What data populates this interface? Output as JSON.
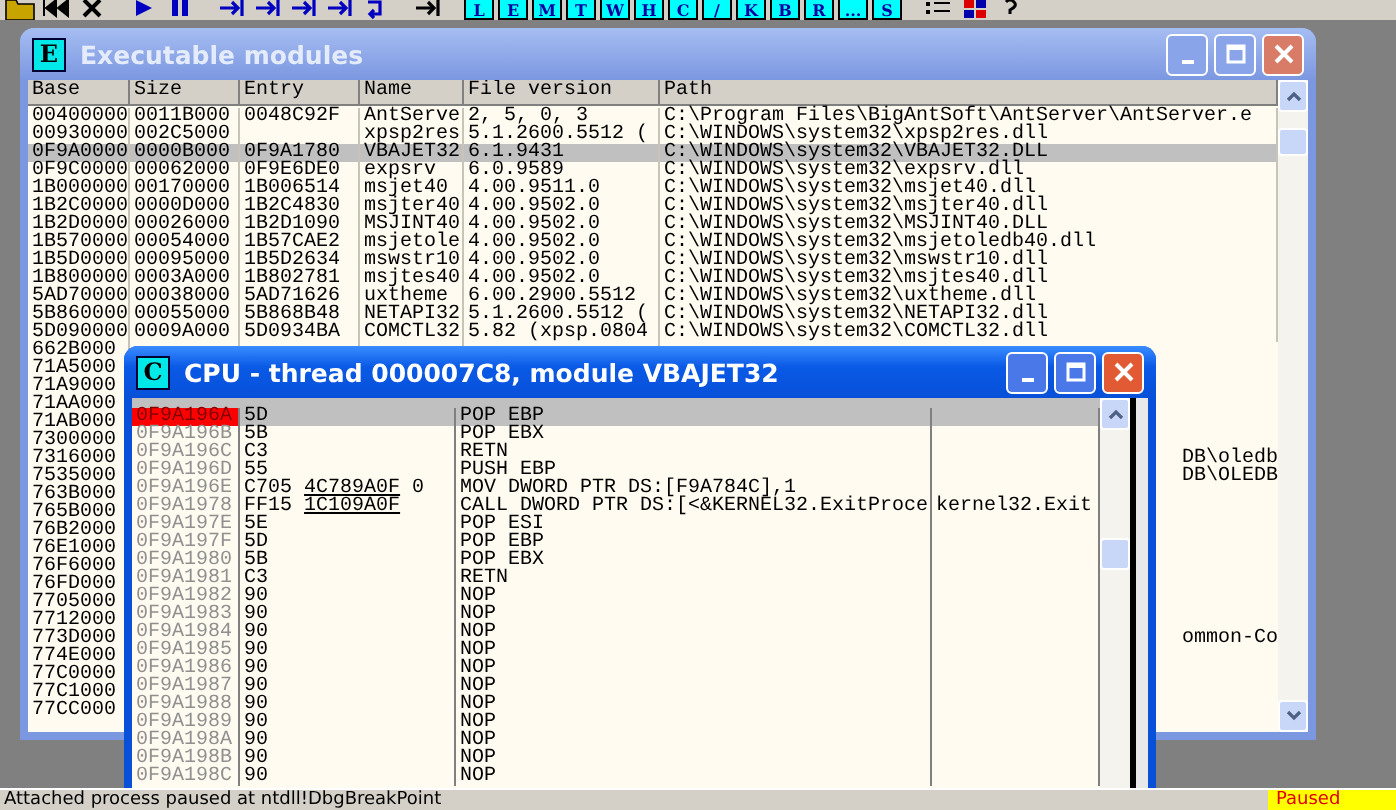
{
  "toolbar": {
    "letter_buttons": [
      "L",
      "E",
      "M",
      "T",
      "W",
      "H",
      "C",
      "/",
      "K",
      "B",
      "R",
      "...",
      "S"
    ]
  },
  "modules_window": {
    "badge": "E",
    "title": "Executable modules",
    "active": false,
    "columns": [
      "Base",
      "Size",
      "Entry",
      "Name",
      "File version",
      "Path"
    ],
    "rows": [
      {
        "base": "00400000",
        "size": "0011B000",
        "entry": "0048C92F",
        "name": "AntServe",
        "file_version": "2, 5, 0, 3",
        "path": "C:\\Program Files\\BigAntSoft\\AntServer\\AntServer.e",
        "selected": false
      },
      {
        "base": "00930000",
        "size": "002C5000",
        "name": "xpsp2res",
        "file_version": "5.1.2600.5512 (",
        "path": "C:\\WINDOWS\\system32\\xpsp2res.dll",
        "selected": false
      },
      {
        "base": "0F9A0000",
        "size": "0000B000",
        "entry": "0F9A1780",
        "name": "VBAJET32",
        "file_version": "6.1.9431",
        "path": "C:\\WINDOWS\\system32\\VBAJET32.DLL",
        "selected": true
      },
      {
        "base": "0F9C0000",
        "size": "00062000",
        "entry": "0F9E6DE0",
        "name": "expsrv",
        "file_version": "6.0.9589",
        "path": "C:\\WINDOWS\\system32\\expsrv.dll",
        "selected": false
      },
      {
        "base": "1B000000",
        "size": "00170000",
        "entry": "1B006514",
        "name": "msjet40",
        "file_version": "4.00.9511.0",
        "path": "C:\\WINDOWS\\system32\\msjet40.dll",
        "selected": false
      },
      {
        "base": "1B2C0000",
        "size": "0000D000",
        "entry": "1B2C4830",
        "name": "msjter40",
        "file_version": "4.00.9502.0",
        "path": "C:\\WINDOWS\\system32\\msjter40.dll",
        "selected": false
      },
      {
        "base": "1B2D0000",
        "size": "00026000",
        "entry": "1B2D1090",
        "name": "MSJINT40",
        "file_version": "4.00.9502.0",
        "path": "C:\\WINDOWS\\system32\\MSJINT40.DLL",
        "selected": false
      },
      {
        "base": "1B570000",
        "size": "00054000",
        "entry": "1B57CAE2",
        "name": "msjetole",
        "file_version": "4.00.9502.0",
        "path": "C:\\WINDOWS\\system32\\msjetoledb40.dll",
        "selected": false
      },
      {
        "base": "1B5D0000",
        "size": "00095000",
        "entry": "1B5D2634",
        "name": "mswstr10",
        "file_version": "4.00.9502.0",
        "path": "C:\\WINDOWS\\system32\\mswstr10.dll",
        "selected": false
      },
      {
        "base": "1B800000",
        "size": "0003A000",
        "entry": "1B802781",
        "name": "msjtes40",
        "file_version": "4.00.9502.0",
        "path": "C:\\WINDOWS\\system32\\msjtes40.dll",
        "selected": false
      },
      {
        "base": "5AD70000",
        "size": "00038000",
        "entry": "5AD71626",
        "name": "uxtheme",
        "file_version": "6.00.2900.5512",
        "path": "C:\\WINDOWS\\system32\\uxtheme.dll",
        "selected": false
      },
      {
        "base": "5B860000",
        "size": "00055000",
        "entry": "5B868B48",
        "name": "NETAPI32",
        "file_version": "5.1.2600.5512 (",
        "path": "C:\\WINDOWS\\system32\\NETAPI32.dll",
        "selected": false
      },
      {
        "base": "5D090000",
        "size": "0009A000",
        "entry": "5D0934BA",
        "name": "COMCTL32",
        "file_version": "5.82 (xpsp.0804",
        "path": "C:\\WINDOWS\\system32\\COMCTL32.dll",
        "selected": false
      },
      {
        "base": "662B000"
      },
      {
        "base": "71A5000"
      },
      {
        "base": "71A9000"
      },
      {
        "base": "71AA000"
      },
      {
        "base": "71AB000"
      },
      {
        "base": "7300000"
      },
      {
        "base": "7316000",
        "path": "DB\\oledb"
      },
      {
        "base": "7535000",
        "path": "DB\\OLEDB"
      },
      {
        "base": "763B000"
      },
      {
        "base": "765B000"
      },
      {
        "base": "76B2000"
      },
      {
        "base": "76E1000"
      },
      {
        "base": "76F6000"
      },
      {
        "base": "76FD000"
      },
      {
        "base": "7705000"
      },
      {
        "base": "7712000"
      },
      {
        "base": "773D000",
        "path": "ommon-Co"
      },
      {
        "base": "774E000"
      },
      {
        "base": "77C0000"
      },
      {
        "base": "77C1000"
      },
      {
        "base": "77CC000"
      }
    ]
  },
  "cpu_window": {
    "badge": "C",
    "title": "CPU - thread 000007C8, module VBAJET32",
    "active": true,
    "rows": [
      {
        "address": "0F9A196A",
        "hex": "5D",
        "disasm": "POP EBP",
        "current": true,
        "selected": true
      },
      {
        "address": "0F9A196B",
        "hex": "5B",
        "disasm": "POP EBX",
        "current": false,
        "selected": false
      },
      {
        "address": "0F9A196C",
        "hex": "C3",
        "disasm": "RETN",
        "current": false,
        "selected": false
      },
      {
        "address": "0F9A196D",
        "hex": "55",
        "disasm": "PUSH EBP",
        "current": false,
        "selected": false
      },
      {
        "address": "0F9A196E",
        "hex": "C705",
        "hex_ref": "4C789A0F",
        "hex_tail": "0",
        "disasm": "MOV DWORD PTR DS:[F9A784C],1",
        "current": false,
        "selected": false
      },
      {
        "address": "0F9A1978",
        "hex": "FF15",
        "hex_ref": "1C109A0F",
        "disasm": "CALL DWORD PTR DS:[<&KERNEL32.ExitProce",
        "comment": "kernel32.Exit",
        "current": false,
        "selected": false
      },
      {
        "address": "0F9A197E",
        "hex": "5E",
        "disasm": "POP ESI",
        "current": false,
        "selected": false
      },
      {
        "address": "0F9A197F",
        "hex": "5D",
        "disasm": "POP EBP",
        "current": false,
        "selected": false
      },
      {
        "address": "0F9A1980",
        "hex": "5B",
        "disasm": "POP EBX",
        "current": false,
        "selected": false
      },
      {
        "address": "0F9A1981",
        "hex": "C3",
        "disasm": "RETN",
        "current": false,
        "selected": false
      },
      {
        "address": "0F9A1982",
        "hex": "90",
        "disasm": "NOP",
        "current": false,
        "selected": false
      },
      {
        "address": "0F9A1983",
        "hex": "90",
        "disasm": "NOP",
        "current": false,
        "selected": false
      },
      {
        "address": "0F9A1984",
        "hex": "90",
        "disasm": "NOP",
        "current": false,
        "selected": false
      },
      {
        "address": "0F9A1985",
        "hex": "90",
        "disasm": "NOP",
        "current": false,
        "selected": false
      },
      {
        "address": "0F9A1986",
        "hex": "90",
        "disasm": "NOP",
        "current": false,
        "selected": false
      },
      {
        "address": "0F9A1987",
        "hex": "90",
        "disasm": "NOP",
        "current": false,
        "selected": false
      },
      {
        "address": "0F9A1988",
        "hex": "90",
        "disasm": "NOP",
        "current": false,
        "selected": false
      },
      {
        "address": "0F9A1989",
        "hex": "90",
        "disasm": "NOP",
        "current": false,
        "selected": false
      },
      {
        "address": "0F9A198A",
        "hex": "90",
        "disasm": "NOP",
        "current": false,
        "selected": false
      },
      {
        "address": "0F9A198B",
        "hex": "90",
        "disasm": "NOP",
        "current": false,
        "selected": false
      },
      {
        "address": "0F9A198C",
        "hex": "90",
        "disasm": "NOP",
        "current": false,
        "selected": false
      }
    ]
  },
  "status_bar": {
    "message": "Attached process paused at ntdll!DbgBreakPoint",
    "state": "Paused"
  }
}
